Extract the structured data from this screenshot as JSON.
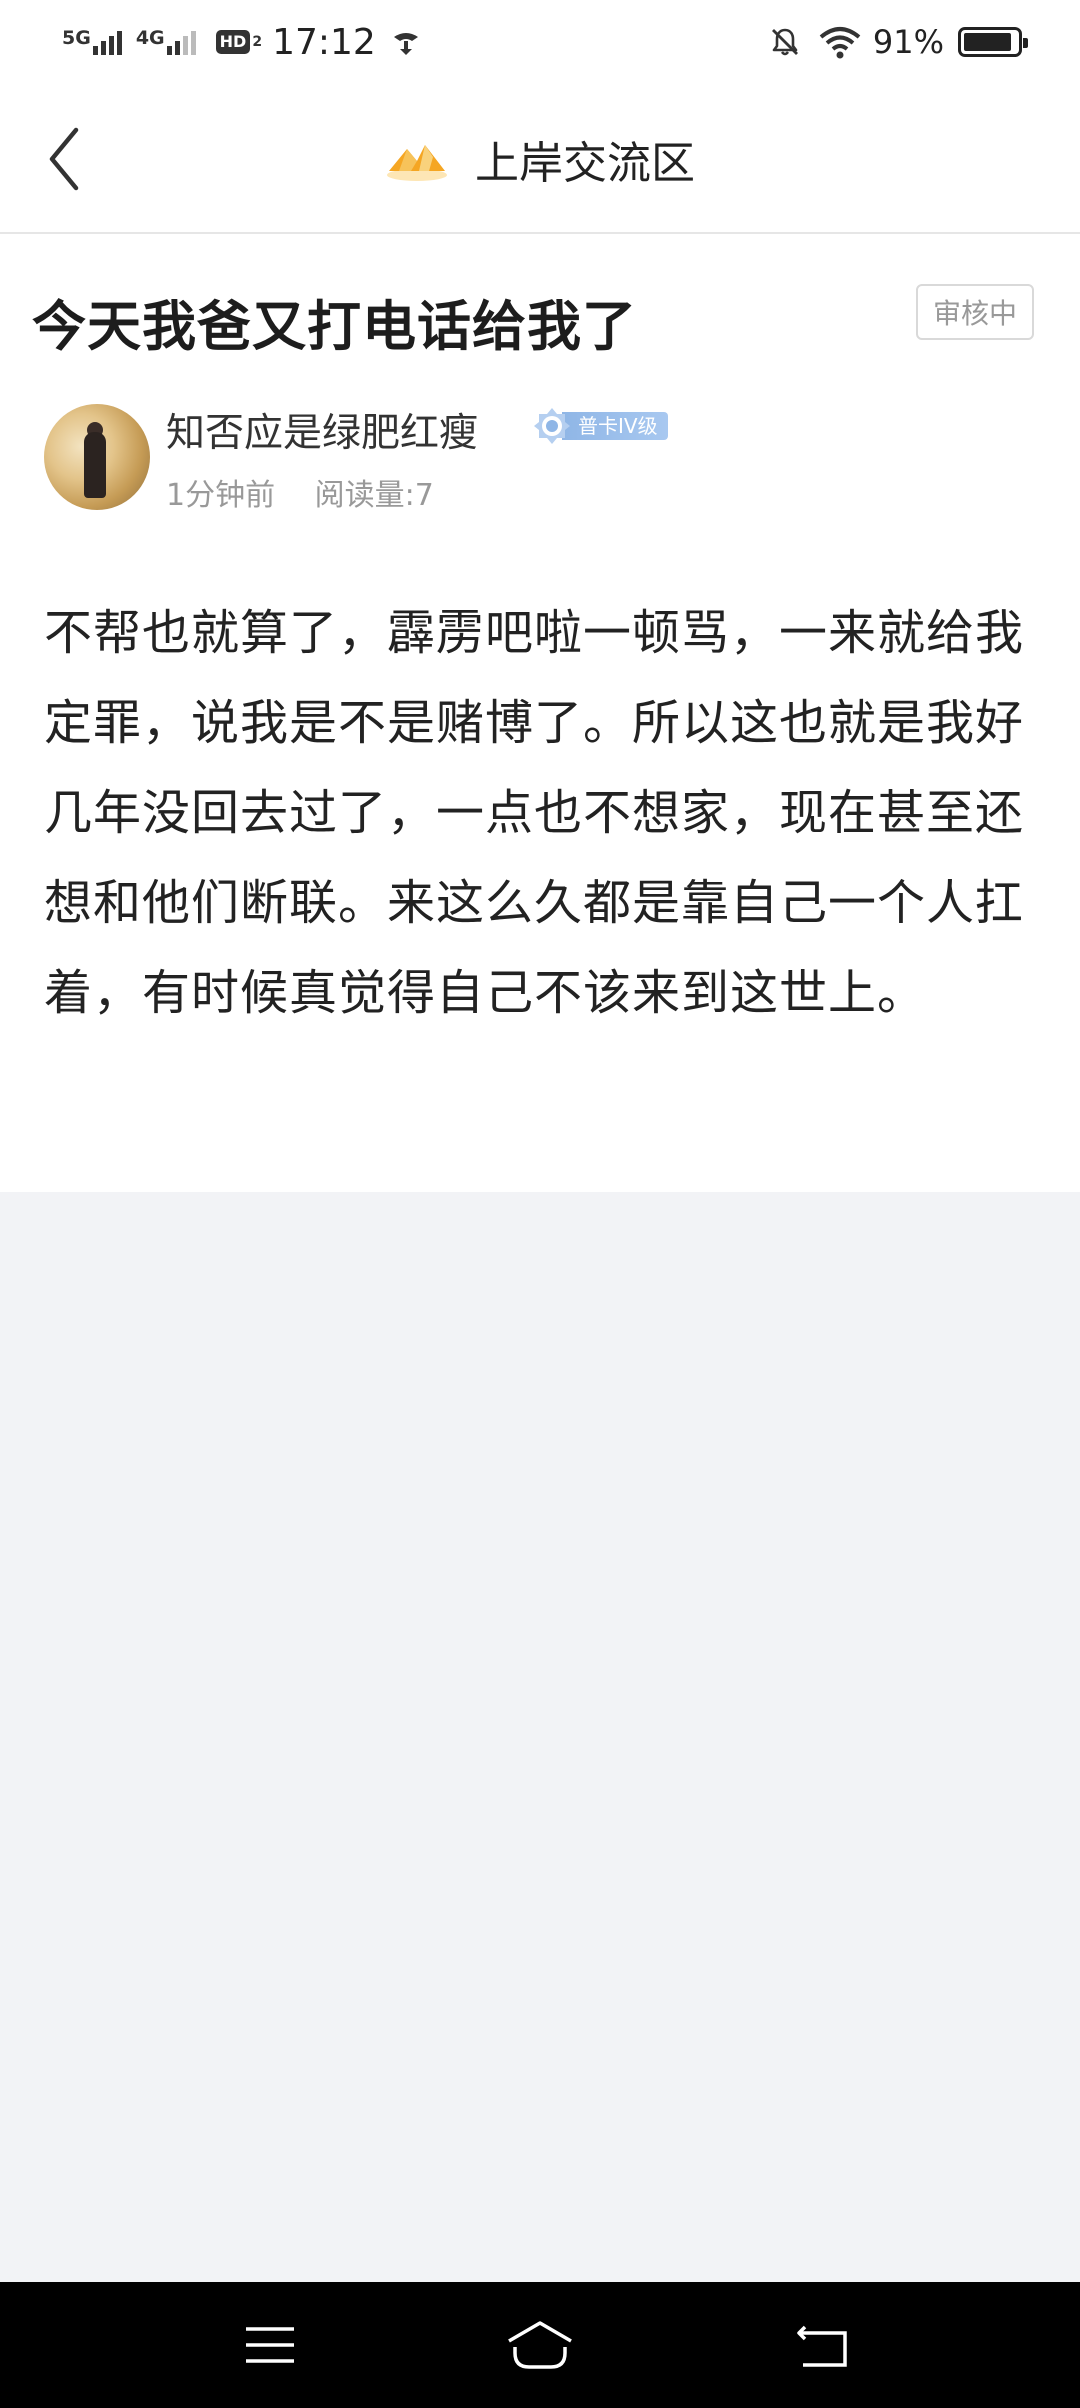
{
  "status_bar": {
    "network1": "5G",
    "network2": "4G",
    "hd_label": "HD",
    "hd_sub": "2",
    "time": "17:12",
    "battery_percent_text": "91%",
    "battery_level": 0.91,
    "icons": [
      "signal-5g-icon",
      "signal-4g-icon",
      "hd-call-icon",
      "status-misc-icon",
      "mute-bell-icon",
      "wifi-icon",
      "battery-icon"
    ]
  },
  "header": {
    "back_icon": "back-chevron-icon",
    "logo_icon": "mountain-sun-logo",
    "title": "上岸交流区"
  },
  "post": {
    "title": "今天我爸又打电话给我了",
    "status_badge": "审核中",
    "author": {
      "name": "知否应是绿肥红瘦",
      "level": "普卡IV级",
      "avatar": "avatar-image"
    },
    "time": "1分钟前",
    "read_count": "阅读量:7",
    "body": "不帮也就算了，霹雳吧啦一顿骂，一来就给我定罪，说我是不是赌博了。所以这也就是我好几年没回去过了，一点也不想家，现在甚至还想和他们断联。来这么久都是靠自己一个人扛着，有时候真觉得自己不该来到这世上。"
  },
  "colors": {
    "page_background": "#f2f3f6",
    "card_background": "#ffffff",
    "text_primary": "#222222",
    "text_secondary": "#999999",
    "level_badge": "#a8c8f0",
    "logo_orange": "#f5a623",
    "system_nav": "#000000"
  },
  "system_nav": {
    "buttons": [
      "menu-icon",
      "home-icon",
      "back-icon"
    ]
  }
}
